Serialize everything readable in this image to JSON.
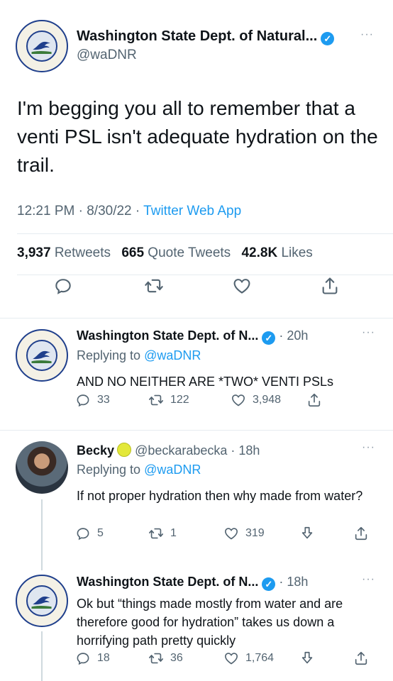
{
  "main_tweet": {
    "display_name": "Washington State Dept. of Natural...",
    "handle": "@waDNR",
    "text": "I'm begging you all to remember that a venti PSL isn't adequate hydration on the trail.",
    "time": "12:21 PM",
    "date": "8/30/22",
    "app": "Twitter Web App",
    "retweets": "3,937",
    "retweets_label": "Retweets",
    "quote_tweets": "665",
    "quote_tweets_label": "Quote Tweets",
    "likes": "42.8K",
    "likes_label": "Likes"
  },
  "replies": [
    {
      "display_name": "Washington State Dept. of N...",
      "time": "20h",
      "replying_to_label": "Replying to",
      "replying_to": "@waDNR",
      "text": "AND NO NEITHER ARE *TWO* VENTI PSLs",
      "reply_count": "33",
      "retweet_count": "122",
      "like_count": "3,948"
    },
    {
      "display_name": "Becky",
      "handle": "@beckarabecka",
      "time": "18h",
      "replying_to_label": "Replying to",
      "replying_to": "@waDNR",
      "text": "If not proper hydration then why made from water?",
      "reply_count": "5",
      "retweet_count": "1",
      "like_count": "319"
    },
    {
      "display_name": "Washington State Dept. of N...",
      "time": "18h",
      "text": "Ok but “things made mostly from water and are therefore good for hydration” takes us down a horrifying path pretty quickly",
      "reply_count": "18",
      "retweet_count": "36",
      "like_count": "1,764"
    }
  ],
  "icons": {
    "reply": "reply-icon",
    "retweet": "retweet-icon",
    "like": "heart-icon",
    "share": "share-icon",
    "download": "download-icon",
    "verified": "verified-badge-icon",
    "more": "more-icon"
  },
  "colors": {
    "accent": "#1d9bf0",
    "secondary_text": "#536471",
    "primary_text": "#0f1419"
  }
}
